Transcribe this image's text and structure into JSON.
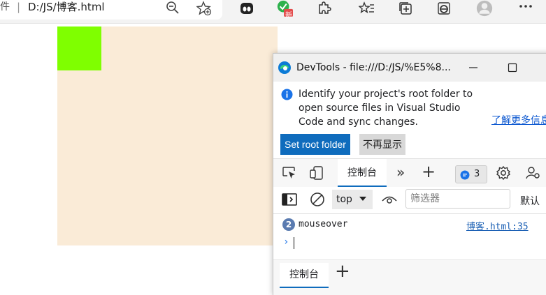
{
  "browser": {
    "address_prefix": "件",
    "address_url": "D:/JS/博客.html",
    "extension_badge": "新"
  },
  "devtools": {
    "window_title": "DevTools - file:///D:/JS/%E5%8...",
    "infobar": {
      "message": "Identify your project's root folder to open source files in Visual Studio Code and sync changes.",
      "learn_more": "了解更多信息",
      "set_root_button": "Set root folder",
      "dismiss_button": "不再显示"
    },
    "tabs": {
      "console": "控制台",
      "more_tabs": "»",
      "add": "+",
      "issues_count": "3"
    },
    "console_toolbar": {
      "context": "top",
      "filter_placeholder": "筛选器",
      "levels": "默认"
    },
    "log": {
      "count": "2",
      "message": "mouseover",
      "source": "博客.html:35"
    },
    "prompt": "›",
    "drawer": {
      "console_tab": "控制台",
      "add": "+"
    }
  },
  "colors": {
    "beige_box": "#faebd7",
    "green_box": "#7fff00",
    "accent": "#0f6cbd"
  }
}
